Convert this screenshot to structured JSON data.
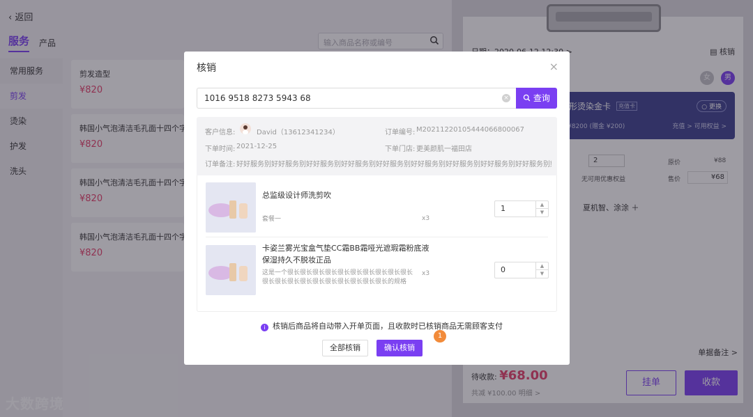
{
  "background": {
    "back_label": "返回",
    "tabs": [
      "服务",
      "产品"
    ],
    "search_placeholder": "输入商品名称或编号",
    "categories": [
      "常用服务",
      "剪发",
      "烫染",
      "护发",
      "洗头"
    ],
    "products": [
      {
        "name": "剪发造型",
        "price": "¥820"
      },
      {
        "name": "韩国小气泡清洁毛孔面十四个字",
        "price": "¥820"
      },
      {
        "name": "韩国小气泡清洁毛孔面十四个字",
        "price": "¥820"
      },
      {
        "name": "韩国小气泡清洁毛孔面十四个字",
        "price": "¥820"
      }
    ],
    "receipt": {
      "date": "日期：2020-06-12 12:30 >",
      "verify": "核销",
      "gender_female": "女",
      "gender_male": "男",
      "card_name": "形烫染金卡",
      "card_tag": "充值卡",
      "card_balance": "¥8200 (赠金 ¥200)",
      "card_change": "更换",
      "card_actions": "充值 >   可用权益 >",
      "qty": "2",
      "original_price_label": "原价",
      "original_price": "¥88",
      "no_discount": "无可用优惠权益",
      "sale_price_label": "售价",
      "sale_price": "¥68",
      "staff": "夏机智、涂涂 ＋",
      "note": "单据备注 >",
      "to_pay_label": "待收款:",
      "to_pay_amount": "¥68.00",
      "discount_text": "共减 ¥100.00 明细 >",
      "hold_button": "挂单",
      "pay_button": "收款"
    },
    "watermark": "大数跨境"
  },
  "modal": {
    "title": "核销",
    "close": "×",
    "code_value": "1016 9518 8273 5943 68",
    "query_button": "查询",
    "customer_label": "客户信息:",
    "customer_value": "David（13612341234）",
    "order_no_label": "订单编号:",
    "order_no_value": "M20211220105444066800067",
    "order_time_label": "下单时间:",
    "order_time_value": "2021-12-25",
    "store_label": "下单门店:",
    "store_value": "更美颜肌一福田店",
    "remark_label": "订单备注:",
    "remark_value": "好好服务别好好服务别好好服务别好好服务别好好服务别好好服务别好好服务别好好服务别好好服务别好好服务别好好服务",
    "items": [
      {
        "name": "总监级设计师洗剪吹",
        "spec": "套餐一",
        "count": "x3",
        "qty": "1"
      },
      {
        "name": "卡姿兰雾光宝盒气垫CC霜BB霜哑光遮瑕霜粉底液保湿持久不脱妆正品",
        "spec": "这是一个很长很长很长很长很长很长很长很长很长很长很长很长很长很长很长很长很长很长很长很长的规格",
        "count": "x3",
        "qty": "0"
      }
    ],
    "tip": "核销后商品将自动带入开单页面，且收款时已核销商品无需顾客支付",
    "all_button": "全部核销",
    "confirm_button": "确认核销",
    "badge": "1"
  },
  "colors": {
    "accent": "#7a3ff2",
    "price": "#e53e6a",
    "badge": "#f28b3a",
    "card": "#3b3f8f"
  }
}
